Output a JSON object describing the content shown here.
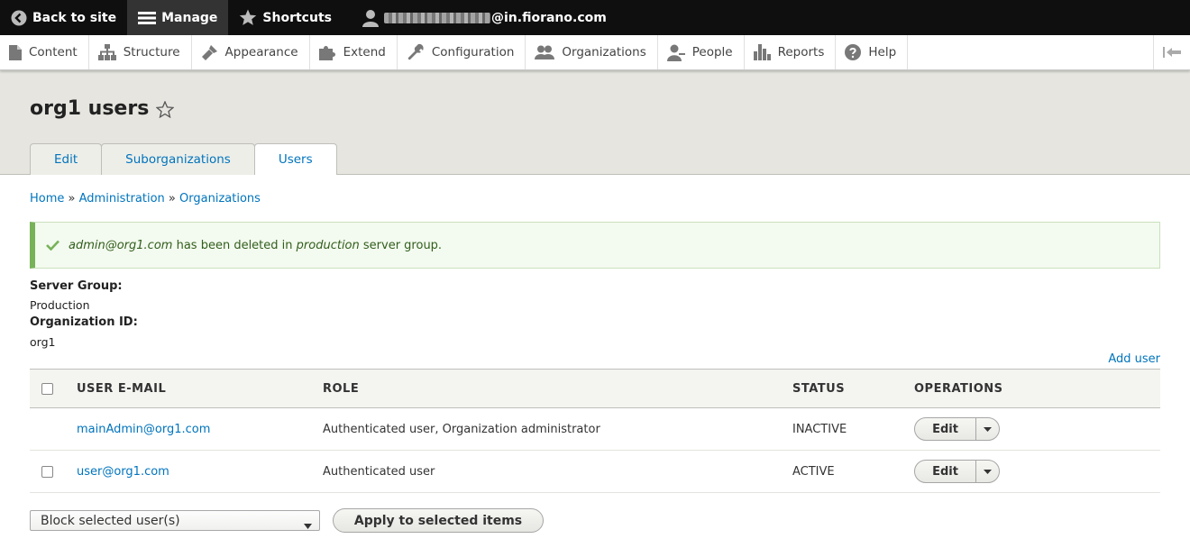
{
  "toolbar": {
    "back_label": "Back to site",
    "manage_label": "Manage",
    "shortcuts_label": "Shortcuts",
    "user_email_visible": "@in.fiorano.com"
  },
  "tray": {
    "items": [
      {
        "label": "Content",
        "icon": "file-icon"
      },
      {
        "label": "Structure",
        "icon": "structure-icon"
      },
      {
        "label": "Appearance",
        "icon": "paintbrush-icon"
      },
      {
        "label": "Extend",
        "icon": "puzzle-icon"
      },
      {
        "label": "Configuration",
        "icon": "wrench-icon"
      },
      {
        "label": "Organizations",
        "icon": "group-icon"
      },
      {
        "label": "People",
        "icon": "people-icon"
      },
      {
        "label": "Reports",
        "icon": "bar-chart-icon"
      },
      {
        "label": "Help",
        "icon": "help-icon"
      }
    ]
  },
  "page": {
    "title": "org1 users",
    "tabs": [
      {
        "label": "Edit",
        "active": false
      },
      {
        "label": "Suborganizations",
        "active": false
      },
      {
        "label": "Users",
        "active": true
      }
    ]
  },
  "breadcrumb": {
    "items": [
      "Home",
      "Administration",
      "Organizations"
    ],
    "separator": "»"
  },
  "message": {
    "email": "admin@org1.com",
    "text1": "has been deleted in",
    "group": "production",
    "text2": "server group."
  },
  "meta": {
    "server_group_label": "Server Group:",
    "server_group_value": "Production",
    "org_id_label": "Organization ID:",
    "org_id_value": "org1"
  },
  "add_user_label": "Add user",
  "table": {
    "headers": {
      "email": "USER E-MAIL",
      "role": "ROLE",
      "status": "STATUS",
      "operations": "OPERATIONS"
    },
    "rows": [
      {
        "email": "mainAdmin@org1.com",
        "role": "Authenticated user, Organization administrator",
        "status": "INACTIVE",
        "op": "Edit",
        "has_checkbox": false
      },
      {
        "email": "user@org1.com",
        "role": "Authenticated user",
        "status": "ACTIVE",
        "op": "Edit",
        "has_checkbox": true
      }
    ]
  },
  "bulk": {
    "selected_action": "Block selected user(s)",
    "apply_label": "Apply to selected items"
  },
  "colors": {
    "link": "#0074bd",
    "toolbar_bg": "#0f0f0f",
    "header_bg": "#e6e5df",
    "success_border": "#77b259"
  }
}
